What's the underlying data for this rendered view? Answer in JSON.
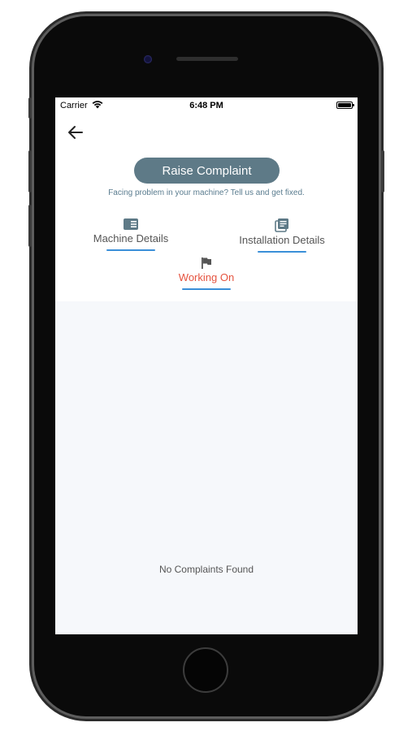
{
  "status_bar": {
    "carrier": "Carrier",
    "time": "6:48 PM"
  },
  "header": {
    "raise_complaint_label": "Raise Complaint",
    "subtitle": "Facing problem in your machine? Tell us and get fixed."
  },
  "tabs": [
    {
      "label": "Machine Details",
      "icon": "card-icon",
      "active": false
    },
    {
      "label": "Installation Details",
      "icon": "list-document-icon",
      "active": false
    },
    {
      "label": "Working On",
      "icon": "flag-icon",
      "active": true
    }
  ],
  "content": {
    "empty_message": "No Complaints Found"
  },
  "colors": {
    "button_bg": "#5e7a87",
    "active_tab": "#e5533f",
    "underline": "#3a8fd8",
    "content_bg": "#f6f8fb"
  }
}
